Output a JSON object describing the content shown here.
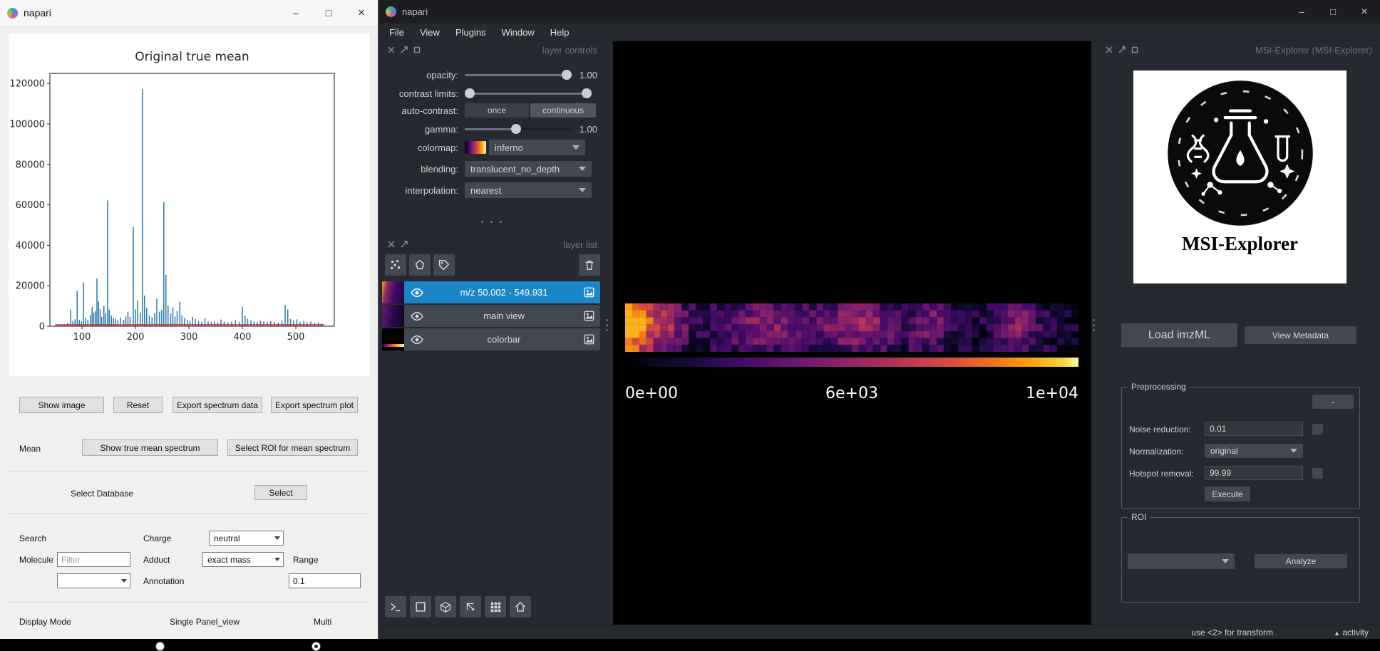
{
  "colors": {
    "selection_blue": "#1a85c9",
    "panel_bg": "#262930",
    "widget_bg": "#414851",
    "canvas_bg": "#000000",
    "spectrum_blue": "#2779b0",
    "baseline_red": "#e02020"
  },
  "chart_data": {
    "type": "bar",
    "title": "Original true mean",
    "xlabel": "",
    "ylabel": "",
    "xlim": [
      40,
      572
    ],
    "ylim": [
      0,
      125000
    ],
    "xticks": [
      100,
      200,
      300,
      400,
      500
    ],
    "yticks": [
      0,
      20000,
      40000,
      60000,
      80000,
      100000,
      120000
    ],
    "series_color": "#2779b0",
    "baseline_color": "#e02020",
    "baseline": {
      "x0": 50,
      "x1": 553,
      "y": 700
    },
    "peaks": [
      [
        55,
        400
      ],
      [
        61,
        600
      ],
      [
        67,
        900
      ],
      [
        73,
        1500
      ],
      [
        79,
        8200
      ],
      [
        83,
        2600
      ],
      [
        87,
        3400
      ],
      [
        91,
        17600
      ],
      [
        95,
        3100
      ],
      [
        99,
        2400
      ],
      [
        103,
        21600
      ],
      [
        107,
        4200
      ],
      [
        111,
        3100
      ],
      [
        116,
        5600
      ],
      [
        119,
        9600
      ],
      [
        122,
        6800
      ],
      [
        125,
        7400
      ],
      [
        128,
        23600
      ],
      [
        131,
        12200
      ],
      [
        134,
        8400
      ],
      [
        137,
        4600
      ],
      [
        141,
        10200
      ],
      [
        144,
        6300
      ],
      [
        148,
        62200
      ],
      [
        151,
        8200
      ],
      [
        155,
        5200
      ],
      [
        159,
        4100
      ],
      [
        163,
        3600
      ],
      [
        167,
        2900
      ],
      [
        172,
        4200
      ],
      [
        178,
        3100
      ],
      [
        182,
        4800
      ],
      [
        186,
        7200
      ],
      [
        190,
        4600
      ],
      [
        196,
        49200
      ],
      [
        200,
        8300
      ],
      [
        204,
        12600
      ],
      [
        209,
        6800
      ],
      [
        213,
        117200
      ],
      [
        217,
        15200
      ],
      [
        221,
        9100
      ],
      [
        226,
        5300
      ],
      [
        231,
        4400
      ],
      [
        236,
        6600
      ],
      [
        240,
        13600
      ],
      [
        245,
        7200
      ],
      [
        249,
        8100
      ],
      [
        253,
        61300
      ],
      [
        257,
        25400
      ],
      [
        261,
        10200
      ],
      [
        266,
        6200
      ],
      [
        270,
        9300
      ],
      [
        274,
        4800
      ],
      [
        278,
        7600
      ],
      [
        283,
        12200
      ],
      [
        287,
        5400
      ],
      [
        292,
        4100
      ],
      [
        297,
        3200
      ],
      [
        302,
        2600
      ],
      [
        307,
        4600
      ],
      [
        312,
        3600
      ],
      [
        318,
        2700
      ],
      [
        324,
        2200
      ],
      [
        330,
        3900
      ],
      [
        336,
        2400
      ],
      [
        342,
        2100
      ],
      [
        348,
        2600
      ],
      [
        354,
        1900
      ],
      [
        360,
        3300
      ],
      [
        366,
        2300
      ],
      [
        373,
        1800
      ],
      [
        380,
        2300
      ],
      [
        387,
        2900
      ],
      [
        394,
        2100
      ],
      [
        400,
        9600
      ],
      [
        405,
        5100
      ],
      [
        410,
        3600
      ],
      [
        416,
        2900
      ],
      [
        422,
        2400
      ],
      [
        428,
        2000
      ],
      [
        434,
        2700
      ],
      [
        440,
        2300
      ],
      [
        447,
        1900
      ],
      [
        453,
        2500
      ],
      [
        460,
        2100
      ],
      [
        467,
        1700
      ],
      [
        474,
        2600
      ],
      [
        480,
        10600
      ],
      [
        485,
        8200
      ],
      [
        490,
        3600
      ],
      [
        496,
        2800
      ],
      [
        502,
        3400
      ],
      [
        508,
        2200
      ],
      [
        515,
        2600
      ],
      [
        521,
        1900
      ],
      [
        528,
        2300
      ],
      [
        535,
        1600
      ],
      [
        542,
        1900
      ],
      [
        548,
        1400
      ]
    ]
  },
  "left_window": {
    "title": "napari",
    "window_controls": {
      "minimize": "–",
      "maximize": "□",
      "close": "×"
    },
    "actions_row": [
      "Show image",
      "Reset",
      "Export spectrum data",
      "Export spectrum plot"
    ],
    "mean_section": {
      "label": "Mean",
      "show_button": "Show true mean spectrum",
      "roi_button": "Select ROI for mean spectrum"
    },
    "database_section": {
      "label": "Select Database",
      "select_button": "Select"
    },
    "search_section": {
      "search_label": "Search",
      "molecule_label": "Molecule",
      "molecule_placeholder": "Filter",
      "charge_label": "Charge",
      "charge_value": "neutral",
      "adduct_label": "Adduct",
      "adduct_value": "exact mass",
      "range_label": "Range",
      "annotation_label": "Annotation",
      "annotation_value": "0.1"
    },
    "display_mode": {
      "label": "Display Mode",
      "single": {
        "label": "Single Panel_view",
        "selected": false
      },
      "multi": {
        "label": "Multi",
        "selected": true
      }
    }
  },
  "right_window": {
    "title": "napari",
    "window_controls": {
      "minimize": "–",
      "maximize": "□",
      "close": "×"
    },
    "menu": [
      "File",
      "View",
      "Plugins",
      "Window",
      "Help"
    ],
    "layer_controls": {
      "panel_title": "layer controls",
      "rows": {
        "opacity": {
          "label": "opacity:",
          "value": "1.00"
        },
        "contrast": {
          "label": "contrast limits:"
        },
        "autocontrast": {
          "label": "auto-contrast:",
          "once": "once",
          "continuous": "continuous",
          "once_selected": false,
          "continuous_selected": true
        },
        "gamma": {
          "label": "gamma:",
          "value": "1.00"
        },
        "colormap": {
          "label": "colormap:",
          "value": "inferno"
        },
        "blending": {
          "label": "blending:",
          "value": "translucent_no_depth"
        },
        "interpolation": {
          "label": "interpolation:",
          "value": "nearest"
        }
      }
    },
    "layer_list": {
      "panel_title": "layer list",
      "layers": [
        {
          "name": "m/z 50.002 - 549.931",
          "selected": true
        },
        {
          "name": "main view",
          "selected": false
        },
        {
          "name": "colorbar",
          "selected": false
        }
      ]
    },
    "viewer": {
      "colorbar_labels": [
        "0e+00",
        "6e+03",
        "1e+04"
      ]
    },
    "plugin": {
      "panel_title": "MSI-Explorer (MSI-Explorer)",
      "logo_title": "MSI-Explorer",
      "load_imzml": "Load imzML",
      "view_metadata": "View Metadata",
      "preprocessing": {
        "title": "Preprocessing",
        "collapse": "-",
        "noise_label": "Noise reduction:",
        "noise_value": "0.01",
        "normalization_label": "Normalization:",
        "normalization_value": "original",
        "hotspot_label": "Hotspot removal:",
        "hotspot_value": "99.99",
        "execute": "Execute"
      },
      "roi": {
        "title": "ROI",
        "analyze": "Analyze"
      }
    },
    "status_bar": {
      "transform_hint": "use <2> for transform",
      "activity": "activity"
    }
  }
}
